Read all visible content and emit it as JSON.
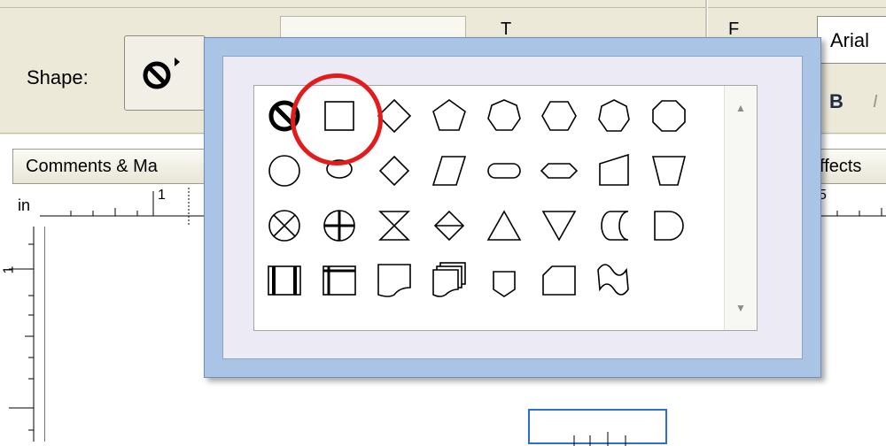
{
  "toolbar": {
    "shape_label": "Shape:",
    "font_value": "Arial",
    "bold_label": "B",
    "tab_left": "Comments & Ma",
    "tab_right": "ffects",
    "ghost_text_a": "T",
    "ghost_text_b": "F"
  },
  "ruler": {
    "unit": "in",
    "marks": [
      "1",
      "5"
    ],
    "vertical_marks": [
      "1"
    ]
  },
  "shape_picker": {
    "selected": "rectangle",
    "highlight_color": "#e31b1b",
    "rows": [
      [
        "no-fill",
        "rectangle",
        "diamond",
        "pentagon",
        "heptagon",
        "hexagon",
        "heptagon-2",
        "octagon"
      ],
      [
        "circle",
        "ellipse",
        "decision",
        "parallelogram",
        "terminator",
        "preparation",
        "manual-input",
        "manual-operation"
      ],
      [
        "or",
        "summing-junction",
        "collate",
        "sort",
        "extract",
        "merge",
        "stored-data",
        "delay"
      ],
      [
        "predefined-process",
        "internal-storage",
        "document",
        "multidocument",
        "off-page-connector",
        "card",
        "punched-tape"
      ]
    ]
  }
}
